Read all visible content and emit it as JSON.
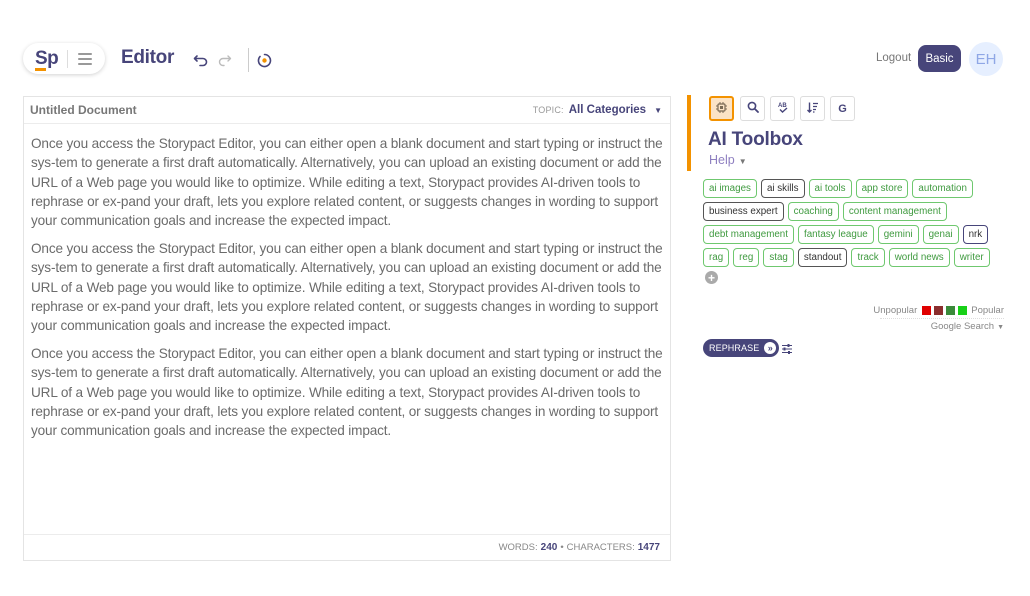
{
  "header": {
    "logo": "Sp",
    "app_title": "Editor",
    "logout": "Logout",
    "plan": "Basic",
    "avatar_initials": "EH",
    "icons": [
      "menu-icon",
      "undo-icon",
      "redo-icon",
      "loader-icon"
    ]
  },
  "editor": {
    "doc_title": "Untitled Document",
    "topic_label": "TOPIC:",
    "topic_value": "All Categories",
    "paragraphs": [
      "Once you access the Storypact Editor, you can either open a blank document and start typing or instruct the sys-tem to generate a first draft automatically. Alternatively, you can upload an existing document or add the URL of a Web page you would like to optimize. While editing a text, Storypact provides AI-driven tools to rephrase or ex-pand your draft, lets you explore related content, or suggests changes in wording to support your communication goals and increase the expected impact.",
      "Once you access the Storypact Editor, you can either open a blank document and start typing or instruct the sys-tem to generate a first draft automatically. Alternatively, you can upload an existing document or add the URL of a Web page you would like to optimize. While editing a text, Storypact provides AI-driven tools to rephrase or ex-pand your draft, lets you explore related content, or suggests changes in wording to support your communication goals and increase the expected impact.",
      "Once you access the Storypact Editor, you can either open a blank document and start typing or instruct the sys-tem to generate a first draft automatically. Alternatively, you can upload an existing document or add the URL of a Web page you would like to optimize. While editing a text, Storypact provides AI-driven tools to rephrase or ex-pand your draft, lets you explore related content, or suggests changes in wording to support your communication goals and increase the expected impact."
    ],
    "footer": {
      "words_label": "WORDS:",
      "words": "240",
      "separator": "•",
      "chars_label": "CHARACTERS:",
      "chars": "1477"
    }
  },
  "sidebar": {
    "tools": [
      {
        "name": "ai-chip-icon",
        "label": "",
        "active": true
      },
      {
        "name": "search-icon",
        "label": "",
        "active": false
      },
      {
        "name": "spellcheck-icon",
        "label": "AB",
        "active": false
      },
      {
        "name": "sort-icon",
        "label": "",
        "active": false
      },
      {
        "name": "google-icon",
        "label": "G",
        "active": false
      }
    ],
    "title": "AI Toolbox",
    "help": "Help",
    "tags": [
      {
        "label": "ai images",
        "style": "green"
      },
      {
        "label": "ai skills",
        "style": "dark"
      },
      {
        "label": "ai tools",
        "style": "green"
      },
      {
        "label": "app store",
        "style": "green"
      },
      {
        "label": "automation",
        "style": "green"
      },
      {
        "label": "business expert",
        "style": "dark"
      },
      {
        "label": "coaching",
        "style": "green"
      },
      {
        "label": "content management",
        "style": "green"
      },
      {
        "label": "debt management",
        "style": "green"
      },
      {
        "label": "fantasy league",
        "style": "green"
      },
      {
        "label": "gemini",
        "style": "green"
      },
      {
        "label": "genai",
        "style": "green"
      },
      {
        "label": "nrk",
        "style": "nrk"
      },
      {
        "label": "rag",
        "style": "green"
      },
      {
        "label": "reg",
        "style": "green"
      },
      {
        "label": "stag",
        "style": "green"
      },
      {
        "label": "standout",
        "style": "dark"
      },
      {
        "label": "track",
        "style": "green"
      },
      {
        "label": "world news",
        "style": "green"
      },
      {
        "label": "writer",
        "style": "green"
      }
    ],
    "add_tag": "+",
    "legend": {
      "low": "Unpopular",
      "high": "Popular",
      "colors": [
        "#e00000",
        "#8b2e2e",
        "#3a8a3a",
        "#18d018"
      ]
    },
    "search_source": "Google Search",
    "rephrase": "REPHRASE",
    "rephrase_go": "»"
  },
  "colors": {
    "brand": "#47457a",
    "accent": "#f39200",
    "tag_green": "#6fc86f"
  }
}
